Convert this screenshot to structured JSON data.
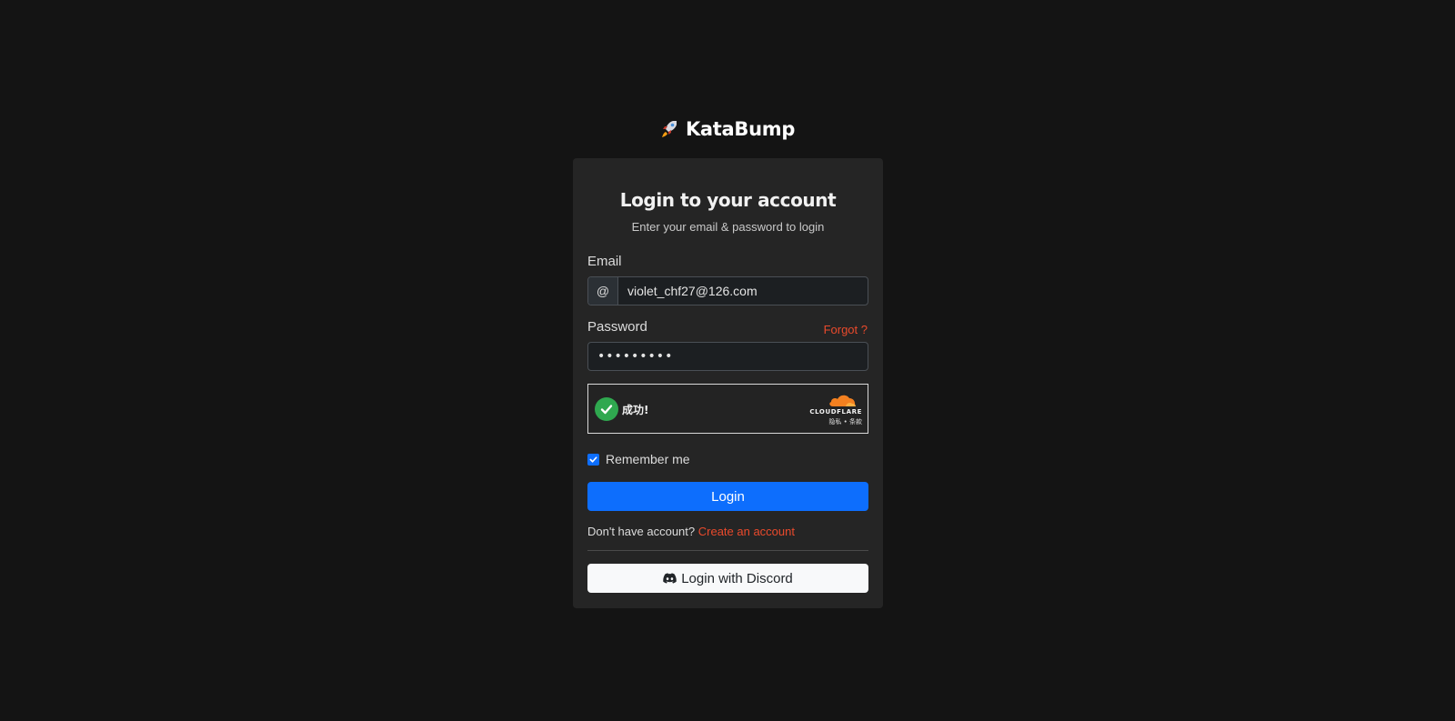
{
  "brand": {
    "name": "KataBump",
    "icon": "rocket-icon"
  },
  "card": {
    "title": "Login to your account",
    "subtitle": "Enter your email & password to login"
  },
  "email": {
    "label": "Email",
    "addon": "@",
    "value": "violet_chf27@126.com"
  },
  "password": {
    "label": "Password",
    "forgot_label": "Forgot ?",
    "value": "•••••••••"
  },
  "captcha": {
    "status_text": "成功!",
    "provider": "CLOUDFLARE",
    "links_text": "隐私 • 条款",
    "success_color": "#2fa84f"
  },
  "remember": {
    "label": "Remember me",
    "checked": true
  },
  "login_button": {
    "label": "Login",
    "color": "#0d6efd"
  },
  "signup": {
    "prompt": "Don't have account?",
    "link_label": "Create an account",
    "link_color": "#ea4a2c"
  },
  "discord_button": {
    "label": "Login with Discord",
    "icon": "discord-icon"
  }
}
